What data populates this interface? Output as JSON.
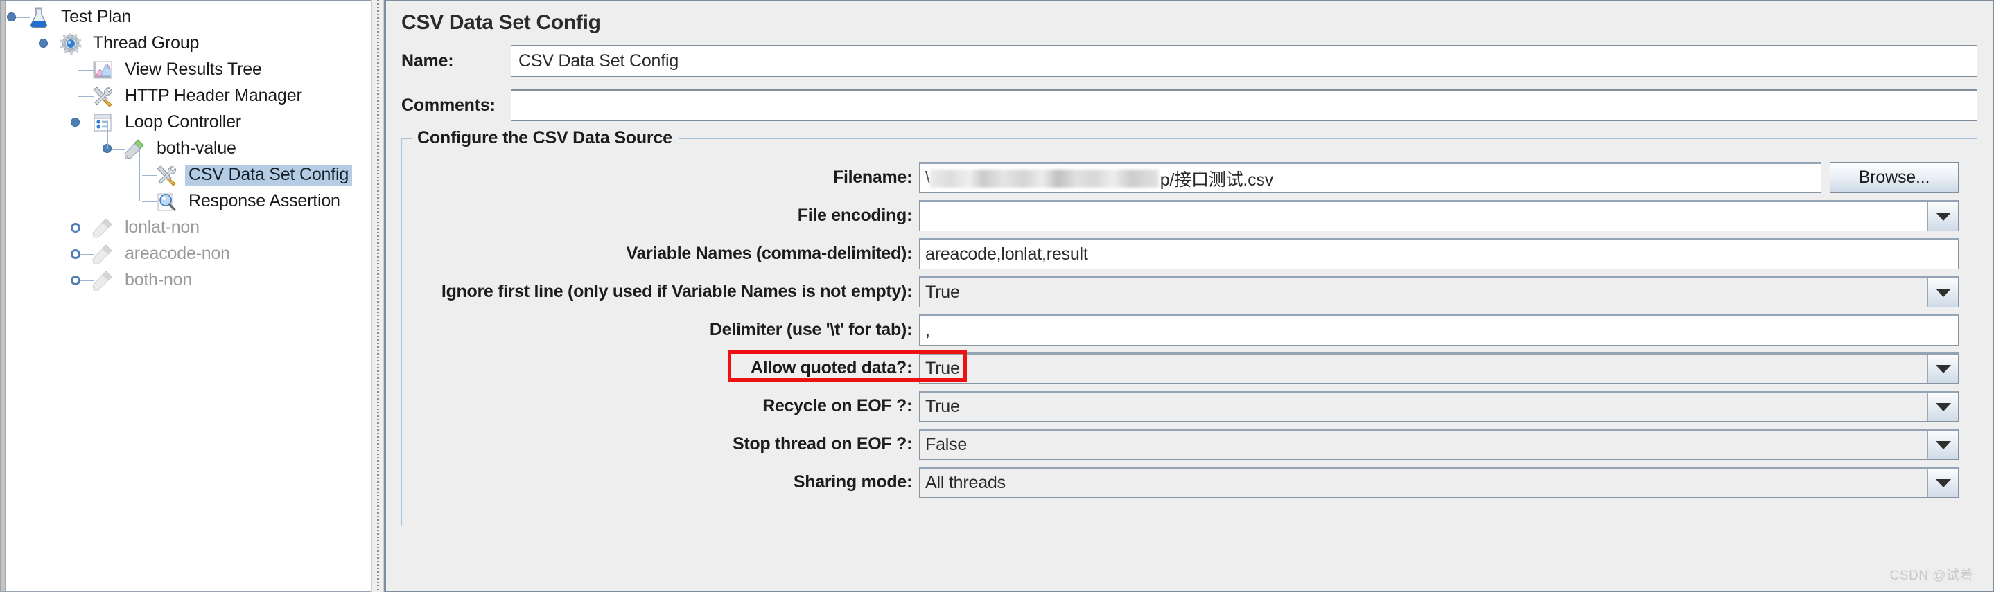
{
  "tree": {
    "items": [
      {
        "label": "Test Plan",
        "icon": "test-plan-icon",
        "depth": 0,
        "selected": false,
        "disabled": false,
        "handle": "expanded"
      },
      {
        "label": "Thread Group",
        "icon": "thread-group-icon",
        "depth": 1,
        "selected": false,
        "disabled": false,
        "handle": "expanded"
      },
      {
        "label": "View Results Tree",
        "icon": "view-results-tree-icon",
        "depth": 2,
        "selected": false,
        "disabled": false,
        "handle": "none"
      },
      {
        "label": "HTTP Header Manager",
        "icon": "http-header-manager-icon",
        "depth": 2,
        "selected": false,
        "disabled": false,
        "handle": "none"
      },
      {
        "label": "Loop Controller",
        "icon": "loop-controller-icon",
        "depth": 2,
        "selected": false,
        "disabled": false,
        "handle": "expanded"
      },
      {
        "label": "both-value",
        "icon": "http-sampler-icon",
        "depth": 3,
        "selected": false,
        "disabled": false,
        "handle": "expanded"
      },
      {
        "label": "CSV Data Set Config",
        "icon": "csv-data-set-config-icon",
        "depth": 4,
        "selected": true,
        "disabled": false,
        "handle": "none"
      },
      {
        "label": "Response Assertion",
        "icon": "response-assertion-icon",
        "depth": 4,
        "selected": false,
        "disabled": false,
        "handle": "none"
      },
      {
        "label": "lonlat-non",
        "icon": "http-sampler-icon",
        "depth": 2,
        "selected": false,
        "disabled": true,
        "handle": "collapsed"
      },
      {
        "label": "areacode-non",
        "icon": "http-sampler-icon",
        "depth": 2,
        "selected": false,
        "disabled": true,
        "handle": "collapsed"
      },
      {
        "label": "both-non",
        "icon": "http-sampler-icon",
        "depth": 2,
        "selected": false,
        "disabled": true,
        "handle": "collapsed"
      }
    ]
  },
  "panel": {
    "title": "CSV Data Set Config",
    "name_label": "Name:",
    "name_value": "CSV Data Set Config",
    "comments_label": "Comments:",
    "comments_value": "",
    "group_title": "Configure the CSV Data Source",
    "browse_label": "Browse...",
    "rows": [
      {
        "label": "Filename:",
        "value": "p/接口测试.csv",
        "type": "text-redacted",
        "has_browse": true
      },
      {
        "label": "File encoding:",
        "value": "",
        "type": "combo-editable",
        "has_browse": false
      },
      {
        "label": "Variable Names (comma-delimited):",
        "value": "areacode,lonlat,result",
        "type": "text",
        "has_browse": false
      },
      {
        "label": "Ignore first line (only used if Variable Names is not empty):",
        "value": "True",
        "type": "combo",
        "has_browse": false
      },
      {
        "label": "Delimiter (use '\\t' for tab):",
        "value": ",",
        "type": "text",
        "has_browse": false
      },
      {
        "label": "Allow quoted data?:",
        "value": "True",
        "type": "combo",
        "has_browse": false,
        "highlighted": true
      },
      {
        "label": "Recycle on EOF ?:",
        "value": "True",
        "type": "combo",
        "has_browse": false
      },
      {
        "label": "Stop thread on EOF ?:",
        "value": "False",
        "type": "combo",
        "has_browse": false
      },
      {
        "label": "Sharing mode:",
        "value": "All threads",
        "type": "combo",
        "has_browse": false
      }
    ]
  },
  "watermark": "CSDN @试着",
  "colors": {
    "selection": "#b4cde4",
    "highlight": "#ee1111",
    "panel_bg": "#eeeeee",
    "border": "#7f8d9c"
  }
}
